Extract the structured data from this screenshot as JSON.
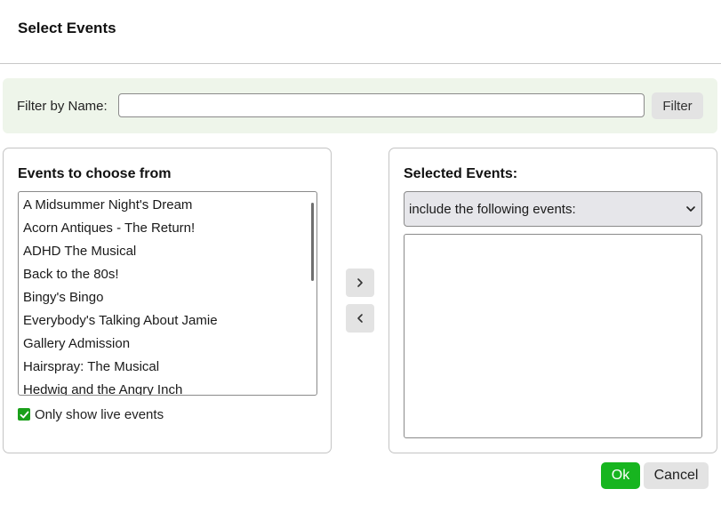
{
  "dialog": {
    "title": "Select Events"
  },
  "filter": {
    "label": "Filter by Name:",
    "value": "",
    "placeholder": "",
    "button_label": "Filter"
  },
  "available": {
    "heading": "Events to choose from",
    "items": [
      "A Midsummer Night's Dream",
      "Acorn Antiques - The Return!",
      "ADHD The Musical",
      "Back to the 80s!",
      "Bingy's Bingo",
      "Everybody's Talking About Jamie",
      "Gallery Admission",
      "Hairspray: The Musical",
      "Hedwig and the Angry Inch"
    ],
    "live_only_label": "Only show live events",
    "live_only_checked": true
  },
  "transfer": {
    "add_icon": "chevron-right-icon",
    "remove_icon": "chevron-left-icon"
  },
  "selected": {
    "heading": "Selected Events:",
    "mode_value": "include the following events:",
    "items": []
  },
  "footer": {
    "ok_label": "Ok",
    "cancel_label": "Cancel"
  },
  "colors": {
    "ok": "#17b51f",
    "checkbox": "#1aa01a",
    "filter_bar": "#eef5ea"
  }
}
